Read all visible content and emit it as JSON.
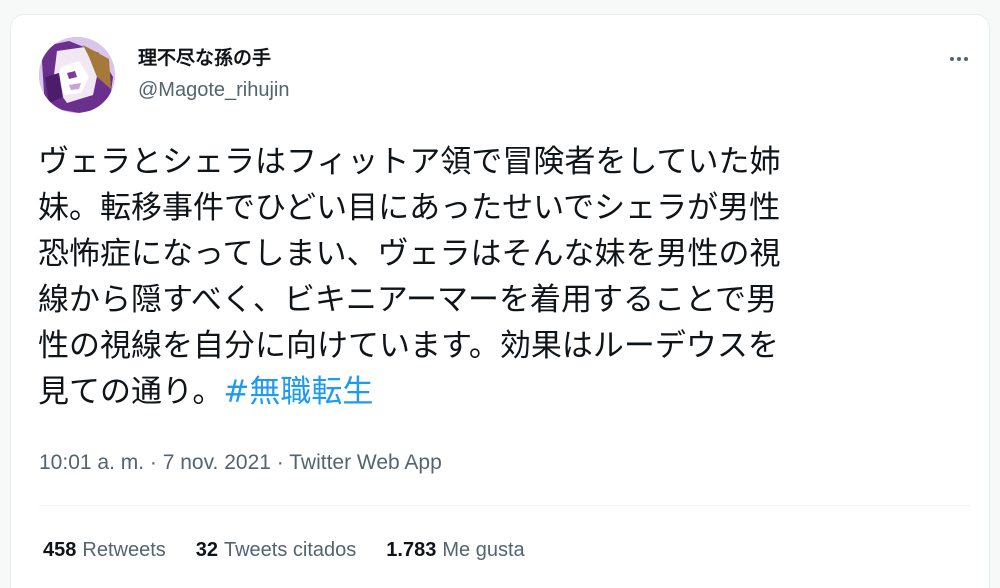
{
  "user": {
    "display_name": "理不尽な孫の手",
    "handle": "@Magote_rihujin"
  },
  "more_icon": "more-horizontal-icon",
  "tweet": {
    "lines": [
      "ヴェラとシェラはフィットア領で冒険者をしていた姉",
      "妹。転移事件でひどい目にあったせいでシェラが男性",
      "恐怖症になってしまい、ヴェラはそんな妹を男性の視",
      "線から隠すべく、ビキニアーマーを着用することで男",
      "性の視線を自分に向けています。効果はルーデウスを"
    ],
    "last_line_text": "見ての通り。",
    "hashtag": "#無職転生"
  },
  "meta": {
    "time": "10:01 a. m.",
    "separator": " · ",
    "date": "7 nov. 2021",
    "source": "Twitter Web App"
  },
  "stats": {
    "retweets_count": "458",
    "retweets_label": "Retweets",
    "quotes_count": "32",
    "quotes_label": "Tweets citados",
    "likes_count": "1.783",
    "likes_label": "Me gusta"
  },
  "colors": {
    "link": "#1d9bf0",
    "secondary_text": "#536471",
    "primary_text": "#0f1419"
  }
}
